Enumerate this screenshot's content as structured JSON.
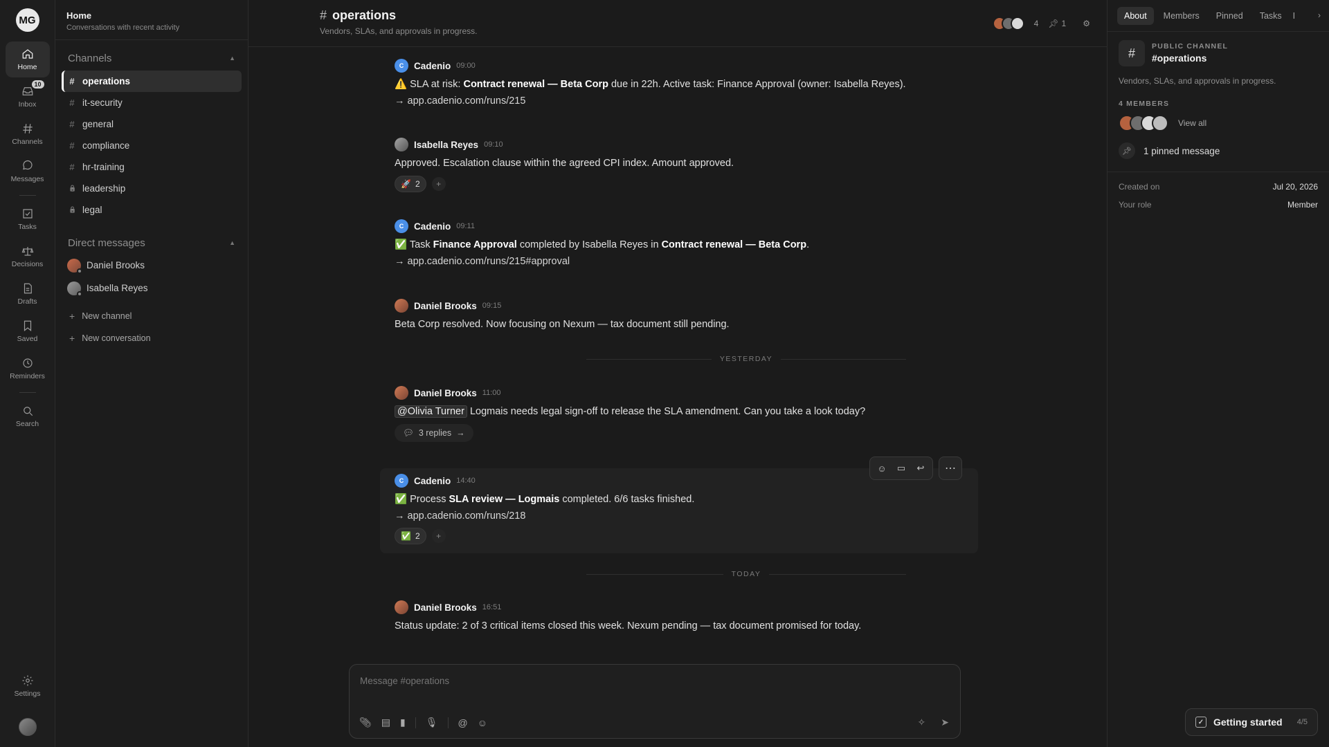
{
  "workspace": {
    "initials": "MG"
  },
  "rail": {
    "items": [
      {
        "label": "Home"
      },
      {
        "label": "Inbox",
        "badge": "10"
      },
      {
        "label": "Channels"
      },
      {
        "label": "Messages"
      },
      {
        "label": "Tasks"
      },
      {
        "label": "Decisions"
      },
      {
        "label": "Drafts"
      },
      {
        "label": "Saved"
      },
      {
        "label": "Reminders"
      },
      {
        "label": "Search"
      }
    ],
    "settings_label": "Settings"
  },
  "sidebar": {
    "title": "Home",
    "subtitle": "Conversations with recent activity",
    "channels_heading": "Channels",
    "channels": [
      {
        "name": "operations",
        "prefix": "#"
      },
      {
        "name": "it-security",
        "prefix": "#"
      },
      {
        "name": "general",
        "prefix": "#"
      },
      {
        "name": "compliance",
        "prefix": "#"
      },
      {
        "name": "hr-training",
        "prefix": "#"
      },
      {
        "name": "leadership",
        "prefix": "🔒"
      },
      {
        "name": "legal",
        "prefix": "🔒"
      }
    ],
    "dm_heading": "Direct messages",
    "dms": [
      {
        "name": "Daniel Brooks"
      },
      {
        "name": "Isabella Reyes"
      }
    ],
    "new_channel": "New channel",
    "new_conversation": "New conversation"
  },
  "header": {
    "hash": "#",
    "channel": "operations",
    "description": "Vendors, SLAs, and approvals in progress.",
    "member_count": "4",
    "pinned_count": "1"
  },
  "messages": [
    {
      "author": "Cadenio",
      "avatar": "C",
      "time": "09:00",
      "emoji": "⚠️",
      "pre": " SLA at risk: ",
      "bold": "Contract renewal — Beta Corp",
      "post": " due in 22h. Active task: Finance Approval (owner: Isabella Reyes).",
      "link": "→ app.cadenio.com/runs/215"
    },
    {
      "author": "Isabella Reyes",
      "time": "09:10",
      "text": "Approved. Escalation clause within the agreed CPI index. Amount approved.",
      "reaction": {
        "emoji": "🚀",
        "count": "2"
      }
    },
    {
      "author": "Cadenio",
      "avatar": "C",
      "time": "09:11",
      "emoji": "✅",
      "pre": " Task ",
      "bold": "Finance Approval",
      "mid": " completed by Isabella Reyes in ",
      "bold2": "Contract renewal — Beta Corp",
      "post": ".",
      "link": "→ app.cadenio.com/runs/215#approval"
    },
    {
      "author": "Daniel Brooks",
      "time": "09:15",
      "text": "Beta Corp resolved. Now focusing on Nexum — tax document still pending."
    },
    {
      "author": "Daniel Brooks",
      "time": "11:00",
      "mention": "@Olivia Turner",
      "text": " Logmais needs legal sign-off to release the SLA amendment. Can you take a look today?",
      "replies": "3 replies"
    },
    {
      "author": "Cadenio",
      "avatar": "C",
      "time": "14:40",
      "emoji": "✅",
      "pre": " Process ",
      "bold": "SLA review — Logmais",
      "post": " completed. 6/6 tasks finished.",
      "link": "→ app.cadenio.com/runs/218",
      "reaction": {
        "emoji": "✅",
        "count": "2"
      }
    },
    {
      "author": "Daniel Brooks",
      "time": "16:51",
      "text": "Status update: 2 of 3 critical items closed this week. Nexum pending — tax document promised for today."
    }
  ],
  "dividers": {
    "yesterday": "YESTERDAY",
    "today": "TODAY"
  },
  "composer": {
    "placeholder": "Message #operations"
  },
  "right_panel": {
    "tabs": [
      "About",
      "Members",
      "Pinned",
      "Tasks",
      "I"
    ],
    "type_label": "PUBLIC CHANNEL",
    "channel": "#operations",
    "description": "Vendors, SLAs, and approvals in progress.",
    "members_label": "4 MEMBERS",
    "view_all": "View all",
    "pinned": "1 pinned message",
    "created_label": "Created on",
    "created_value": "Jul 20, 2026",
    "role_label": "Your role",
    "role_value": "Member",
    "getting_started": "Getting started",
    "getting_started_progress": "4/5"
  }
}
